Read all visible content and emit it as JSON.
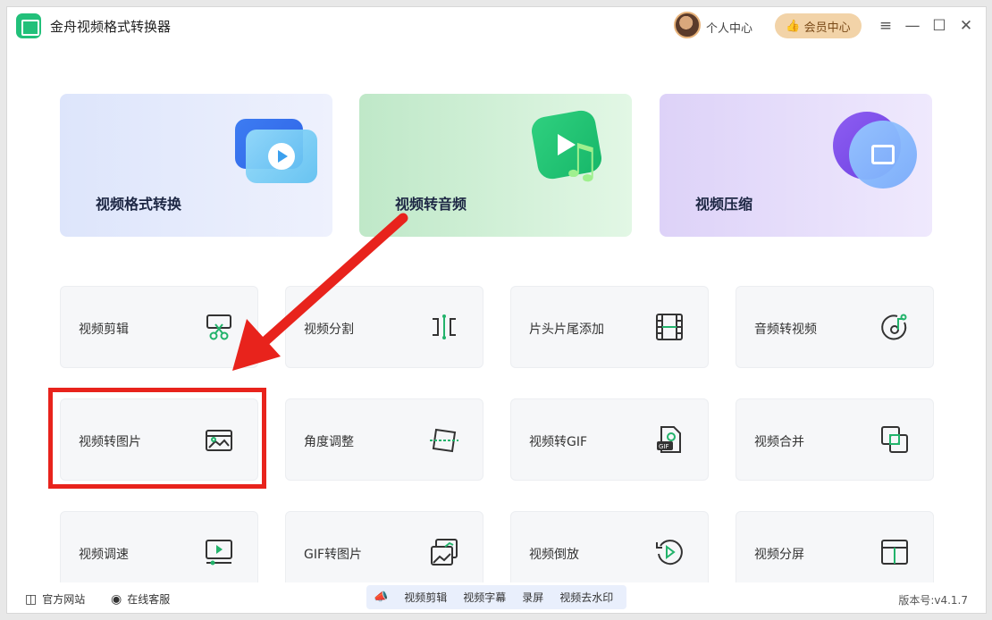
{
  "app": {
    "title": "金舟视频格式转换器"
  },
  "header": {
    "user_center": "个人中心",
    "vip_center": "会员中心"
  },
  "big_cards": [
    {
      "label": "视频格式转换"
    },
    {
      "label": "视频转音频"
    },
    {
      "label": "视频压缩"
    }
  ],
  "tools": [
    {
      "label": "视频剪辑",
      "icon": "scissors-icon"
    },
    {
      "label": "视频分割",
      "icon": "split-icon"
    },
    {
      "label": "片头片尾添加",
      "icon": "film-strip-icon"
    },
    {
      "label": "音频转视频",
      "icon": "music-disc-icon"
    },
    {
      "label": "视频转图片",
      "icon": "image-icon"
    },
    {
      "label": "角度调整",
      "icon": "rotate-icon"
    },
    {
      "label": "视频转GIF",
      "icon": "gif-file-icon"
    },
    {
      "label": "视频合并",
      "icon": "merge-icon"
    },
    {
      "label": "视频调速",
      "icon": "speed-icon"
    },
    {
      "label": "GIF转图片",
      "icon": "gif-image-icon"
    },
    {
      "label": "视频倒放",
      "icon": "reverse-icon"
    },
    {
      "label": "视频分屏",
      "icon": "split-screen-icon"
    }
  ],
  "footer": {
    "website": "官方网站",
    "service": "在线客服",
    "promo": [
      "视频剪辑",
      "视频字幕",
      "录屏",
      "视频去水印"
    ],
    "version_label": "版本号:",
    "version": "v4.1.7"
  },
  "colors": {
    "highlight": "#e8231c",
    "accent": "#22c07a",
    "vip": "#f2d3a8"
  }
}
